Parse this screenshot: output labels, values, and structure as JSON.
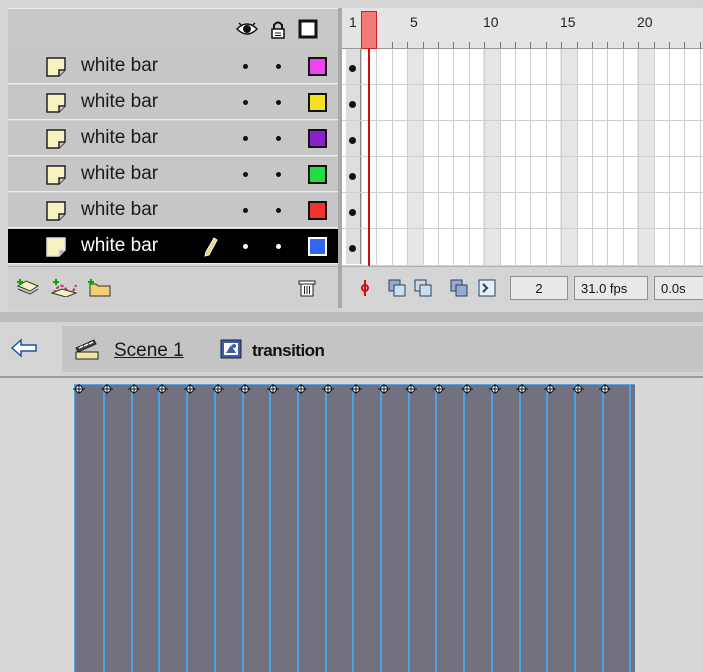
{
  "timeline": {
    "header_icons": [
      "eye-icon",
      "lock-icon",
      "outline-icon"
    ],
    "layers": [
      {
        "name": "white bar",
        "color": "#ee44ee",
        "selected": false
      },
      {
        "name": "white bar",
        "color": "#f4e020",
        "selected": false
      },
      {
        "name": "white bar",
        "color": "#8822cc",
        "selected": false
      },
      {
        "name": "white bar",
        "color": "#22dd44",
        "selected": false
      },
      {
        "name": "white bar",
        "color": "#ee3333",
        "selected": false
      },
      {
        "name": "white bar",
        "color": "#3366ee",
        "selected": true
      }
    ],
    "footer_icons": [
      "insert-layer-icon",
      "add-motion-guide-icon",
      "insert-layer-folder-icon",
      "trash-icon"
    ],
    "ruler_labels": [
      "1",
      "5",
      "10",
      "15",
      "20"
    ],
    "current_frame": "2",
    "fps": "31.0 fps",
    "elapsed": "0.0s"
  },
  "nav": {
    "back_icon": "back-arrow-icon",
    "scene": "Scene 1",
    "symbol": "transition"
  },
  "stage": {
    "bar_color": "#717180",
    "outline_color": "#4aa4e8"
  }
}
